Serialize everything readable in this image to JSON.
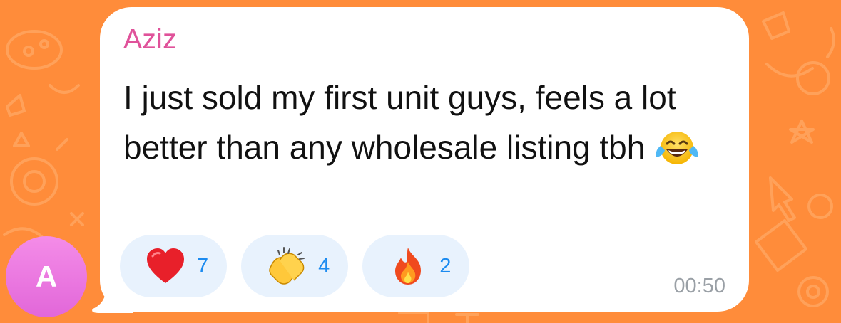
{
  "message": {
    "sender": "Aziz",
    "avatar_letter": "A",
    "text": "I just sold my first unit guys, feels a lot better than any wholesale listing tbh",
    "emoji": "face-with-tears-of-joy",
    "time": "00:50"
  },
  "reactions": [
    {
      "icon": "red-heart-icon",
      "count": "7"
    },
    {
      "icon": "clapping-hands-icon",
      "count": "4"
    },
    {
      "icon": "fire-icon",
      "count": "2"
    }
  ],
  "colors": {
    "wallpaper": "#FF8C3A",
    "sender": "#E0529A",
    "reaction_bg": "#E8F2FD",
    "reaction_count": "#1C8BF0",
    "avatar": "#E267D9"
  }
}
